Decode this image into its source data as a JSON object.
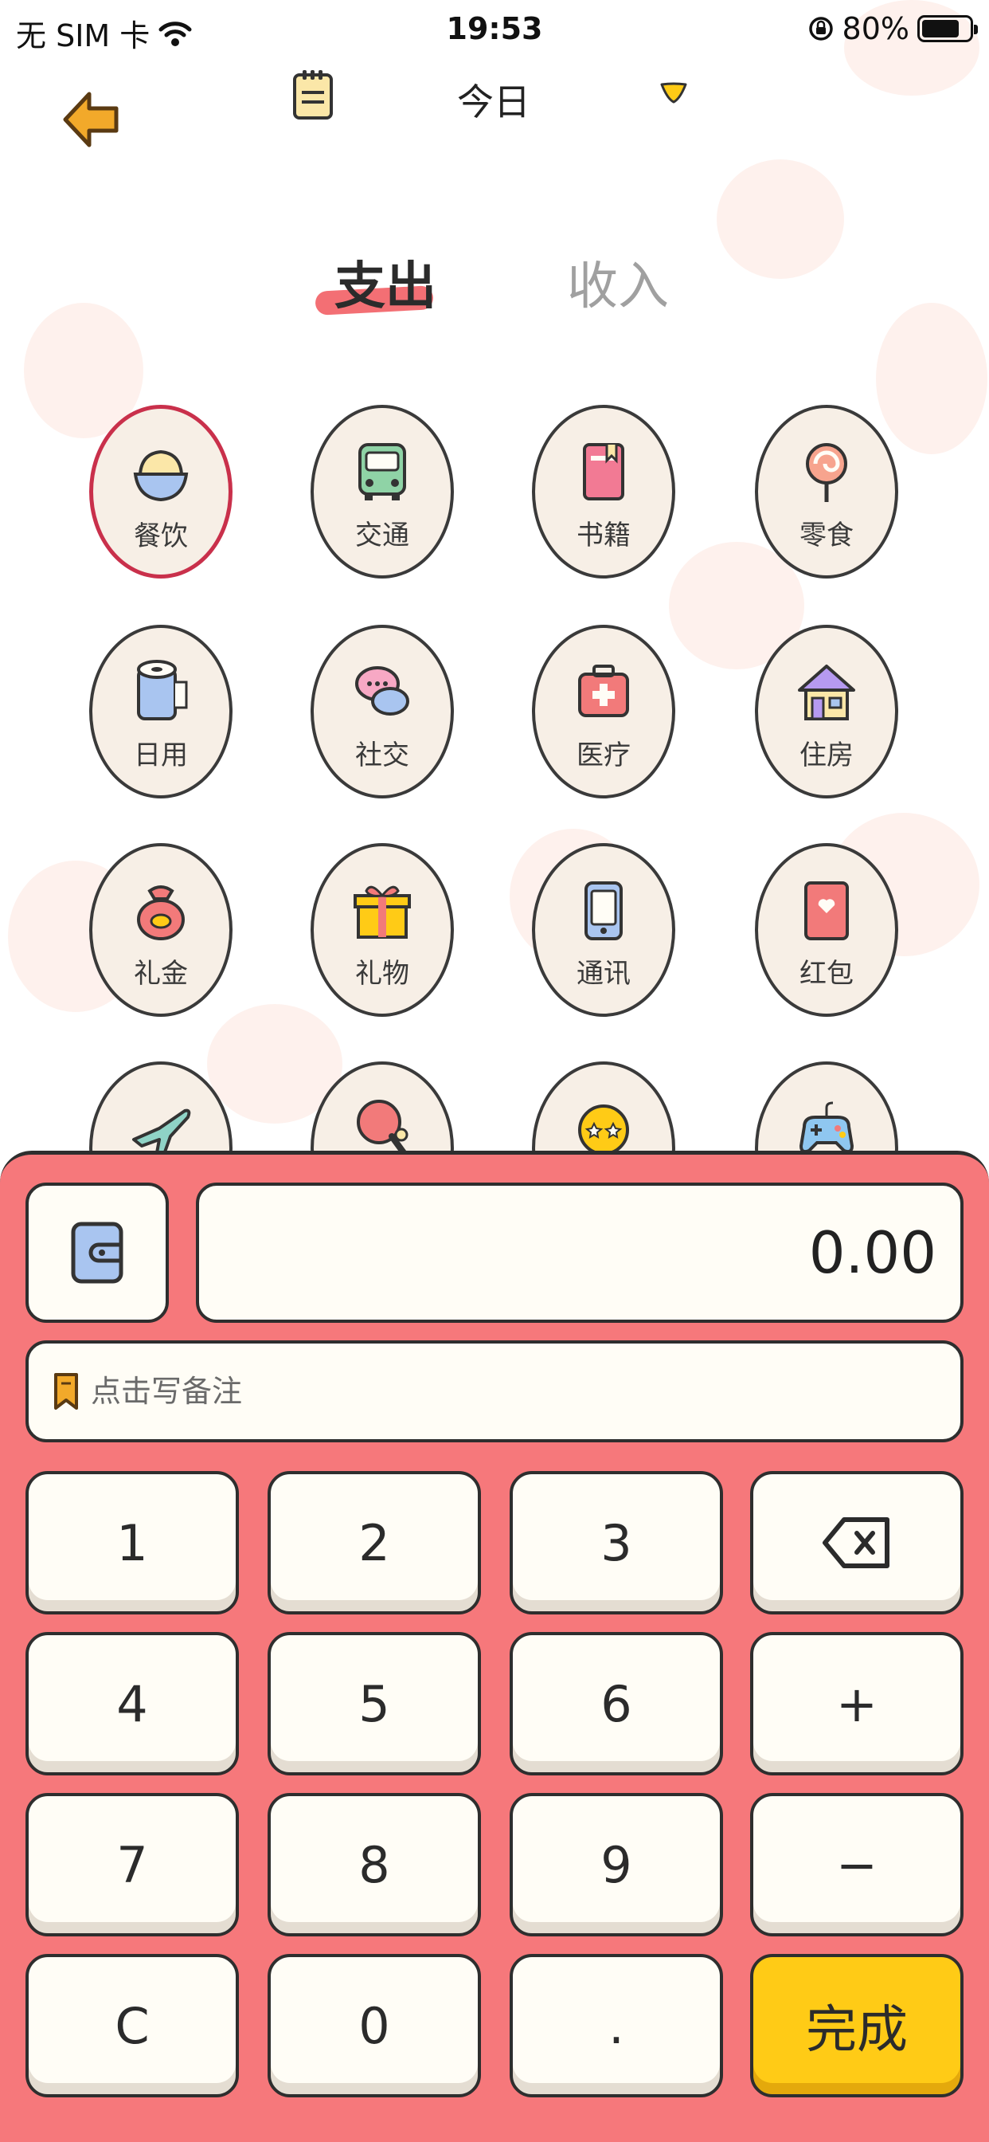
{
  "status_bar": {
    "carrier": "无 SIM 卡",
    "time": "19:53",
    "battery": "80%",
    "battery_level": 0.8
  },
  "header": {
    "date_label": "今日"
  },
  "tabs": [
    {
      "label": "支出",
      "active": true
    },
    {
      "label": "收入",
      "active": false
    }
  ],
  "categories": [
    {
      "label": "餐饮",
      "icon": "rice-bowl-icon",
      "selected": true
    },
    {
      "label": "交通",
      "icon": "bus-icon",
      "selected": false
    },
    {
      "label": "书籍",
      "icon": "book-icon",
      "selected": false
    },
    {
      "label": "零食",
      "icon": "lollipop-icon",
      "selected": false
    },
    {
      "label": "日用",
      "icon": "toilet-paper-icon",
      "selected": false
    },
    {
      "label": "社交",
      "icon": "chat-bubbles-icon",
      "selected": false
    },
    {
      "label": "医疗",
      "icon": "medical-kit-icon",
      "selected": false
    },
    {
      "label": "住房",
      "icon": "house-icon",
      "selected": false
    },
    {
      "label": "礼金",
      "icon": "money-bag-icon",
      "selected": false
    },
    {
      "label": "礼物",
      "icon": "gift-icon",
      "selected": false
    },
    {
      "label": "通讯",
      "icon": "phone-icon",
      "selected": false
    },
    {
      "label": "红包",
      "icon": "red-envelope-icon",
      "selected": false
    },
    {
      "label": "",
      "icon": "airplane-icon",
      "selected": false
    },
    {
      "label": "",
      "icon": "ping-pong-icon",
      "selected": false
    },
    {
      "label": "",
      "icon": "star-eyes-emoji-icon",
      "selected": false
    },
    {
      "label": "",
      "icon": "gamepad-icon",
      "selected": false
    }
  ],
  "amount": "0.00",
  "note": {
    "placeholder": "点击写备注"
  },
  "keypad": {
    "k1": "1",
    "k2": "2",
    "k3": "3",
    "k4": "4",
    "k5": "5",
    "k6": "6",
    "plus": "+",
    "k7": "7",
    "k8": "8",
    "k9": "9",
    "minus": "−",
    "clear": "C",
    "k0": "0",
    "dot": ".",
    "done": "完成"
  },
  "colors": {
    "panel": "#f6787b",
    "accent": "#f36f74",
    "done_button": "#ffcb16",
    "selected_border": "#c9304b"
  }
}
